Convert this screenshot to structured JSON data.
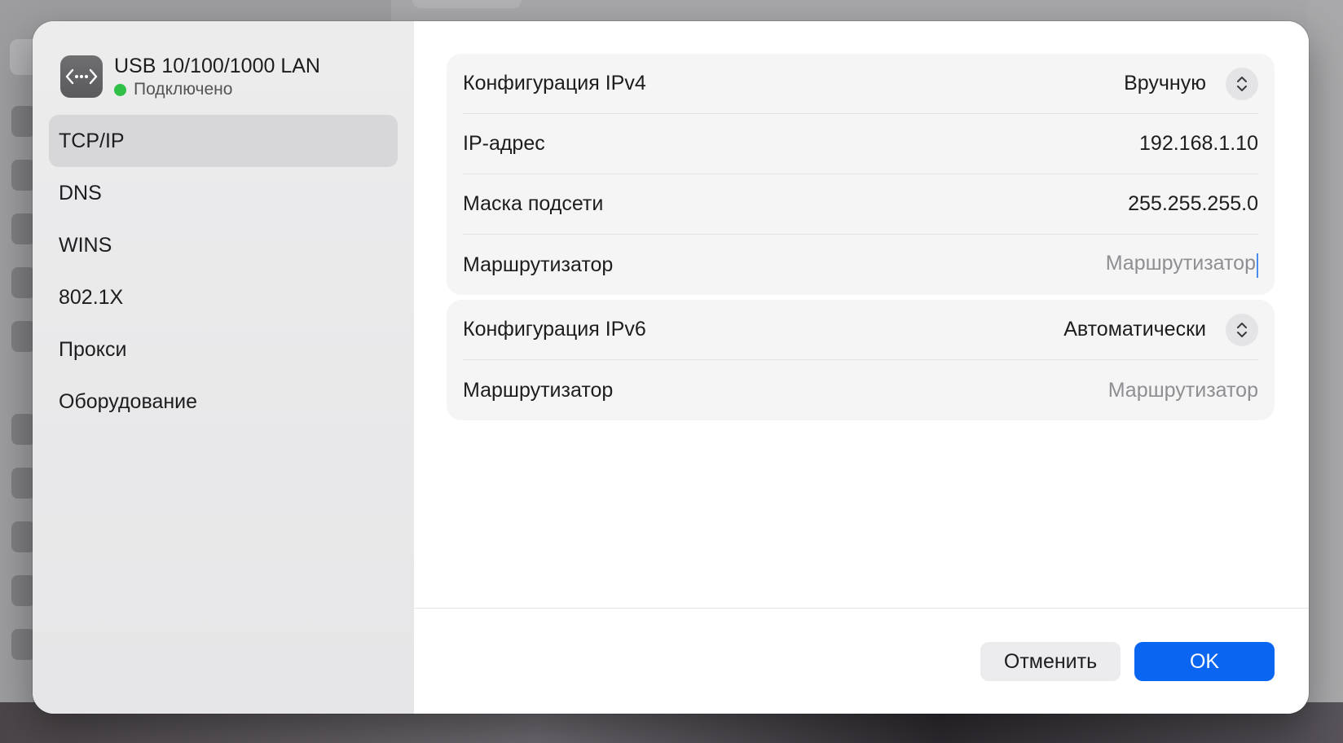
{
  "device": {
    "name": "USB 10/100/1000 LAN",
    "status": "Подключено",
    "icon": "ethernet-dots-icon",
    "status_color": "#30c048"
  },
  "sidebar": {
    "items": [
      {
        "label": "TCP/IP",
        "active": true
      },
      {
        "label": "DNS"
      },
      {
        "label": "WINS"
      },
      {
        "label": "802.1X"
      },
      {
        "label": "Прокси"
      },
      {
        "label": "Оборудование"
      }
    ]
  },
  "ipv4": {
    "config_label": "Конфигурация IPv4",
    "config_value": "Вручную",
    "ip_label": "IP-адрес",
    "ip_value": "192.168.1.10",
    "mask_label": "Маска подсети",
    "mask_value": "255.255.255.0",
    "router_label": "Маршрутизатор",
    "router_placeholder": "Маршрутизатор"
  },
  "ipv6": {
    "config_label": "Конфигурация IPv6",
    "config_value": "Автоматически",
    "router_label": "Маршрутизатор",
    "router_placeholder": "Маршрутизатор"
  },
  "footer": {
    "cancel_label": "Отменить",
    "ok_label": "OK"
  },
  "colors": {
    "accent": "#0a66f0"
  }
}
